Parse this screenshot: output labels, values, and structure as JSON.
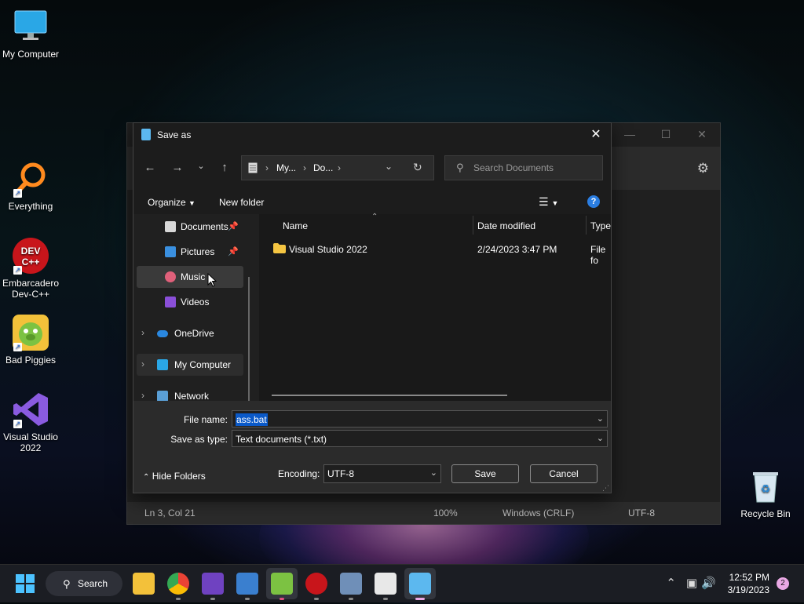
{
  "desktop": {
    "icons": [
      {
        "label": "My Computer"
      },
      {
        "label": "Everything"
      },
      {
        "label": "Embarcadero Dev-C++"
      },
      {
        "label": "Bad Piggies"
      },
      {
        "label": "Visual Studio 2022"
      },
      {
        "label": "Recycle Bin"
      }
    ]
  },
  "notepad": {
    "status": {
      "position": "Ln 3, Col 21",
      "zoom": "100%",
      "line_ending": "Windows (CRLF)",
      "encoding": "UTF-8"
    }
  },
  "dialog": {
    "title": "Save as",
    "breadcrumb": [
      "My...",
      "Do..."
    ],
    "search_placeholder": "Search Documents",
    "organize": "Organize",
    "new_folder": "New folder",
    "nav_items": [
      {
        "label": "Documents",
        "pinned": true
      },
      {
        "label": "Pictures",
        "pinned": true
      },
      {
        "label": "Music"
      },
      {
        "label": "Videos"
      },
      {
        "label": "OneDrive"
      },
      {
        "label": "My Computer"
      },
      {
        "label": "Network"
      }
    ],
    "columns": {
      "name": "Name",
      "date": "Date modified",
      "type": "Type"
    },
    "rows": [
      {
        "name": "Visual Studio 2022",
        "date": "2/24/2023 3:47 PM",
        "type": "File fo"
      }
    ],
    "file_name_label": "File name:",
    "file_name_value": "ass.bat",
    "save_type_label": "Save as type:",
    "save_type_value": "Text documents (*.txt)",
    "hide_folders": "Hide Folders",
    "encoding_label": "Encoding:",
    "encoding_value": "UTF-8",
    "save_button": "Save",
    "cancel_button": "Cancel"
  },
  "taskbar": {
    "search_label": "Search",
    "time": "12:52 PM",
    "date": "3/19/2023",
    "notification_count": "2"
  },
  "colors": {
    "accent": "#0a59c8",
    "folder": "#f5c542",
    "selection": "#3a3a3a"
  }
}
